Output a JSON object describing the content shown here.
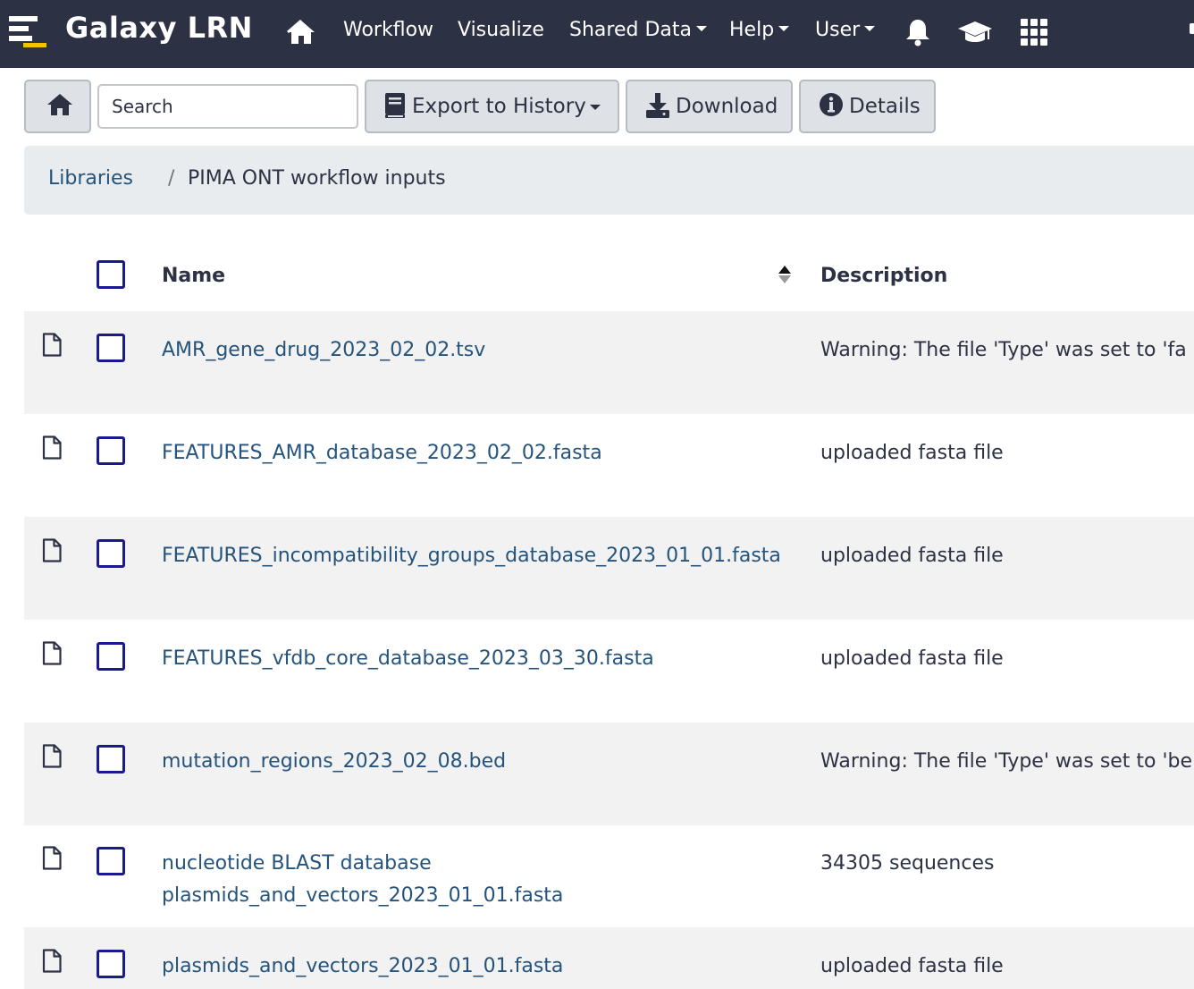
{
  "masthead": {
    "brand": "Galaxy LRN",
    "nav": {
      "workflow": "Workflow",
      "visualize": "Visualize",
      "shared_data": "Shared Data",
      "help": "Help",
      "user": "User"
    },
    "icons": [
      "menu-logo-icon",
      "home-icon",
      "bell-icon",
      "graduation-cap-icon",
      "apps-grid-icon"
    ]
  },
  "toolbar": {
    "search_placeholder": "Search",
    "export_label": "Export to History",
    "download_label": "Download",
    "details_label": "Details"
  },
  "breadcrumb": {
    "root": "Libraries",
    "separator": "/",
    "current": "PIMA ONT workflow inputs"
  },
  "table": {
    "columns": {
      "name": "Name",
      "description": "Description"
    },
    "rows": [
      {
        "name": "AMR_gene_drug_2023_02_02.tsv",
        "description": "Warning: The file 'Type' was set to 'fa"
      },
      {
        "name": "FEATURES_AMR_database_2023_02_02.fasta",
        "description": "uploaded fasta file"
      },
      {
        "name": "FEATURES_incompatibility_groups_database_2023_01_01.fasta",
        "description": "uploaded fasta file"
      },
      {
        "name": "FEATURES_vfdb_core_database_2023_03_30.fasta",
        "description": "uploaded fasta file"
      },
      {
        "name": "mutation_regions_2023_02_08.bed",
        "description": "Warning: The file 'Type' was set to 'be"
      },
      {
        "name": "nucleotide BLAST database plasmids_and_vectors_2023_01_01.fasta",
        "description": "34305 sequences"
      },
      {
        "name": "plasmids_and_vectors_2023_01_01.fasta",
        "description": "uploaded fasta file"
      }
    ]
  },
  "colors": {
    "masthead_bg": "#2c3143",
    "link": "#25537b",
    "checkbox_border": "#1a1a8e",
    "button_bg": "#dee2e6",
    "stripe": "#f2f2f2"
  }
}
